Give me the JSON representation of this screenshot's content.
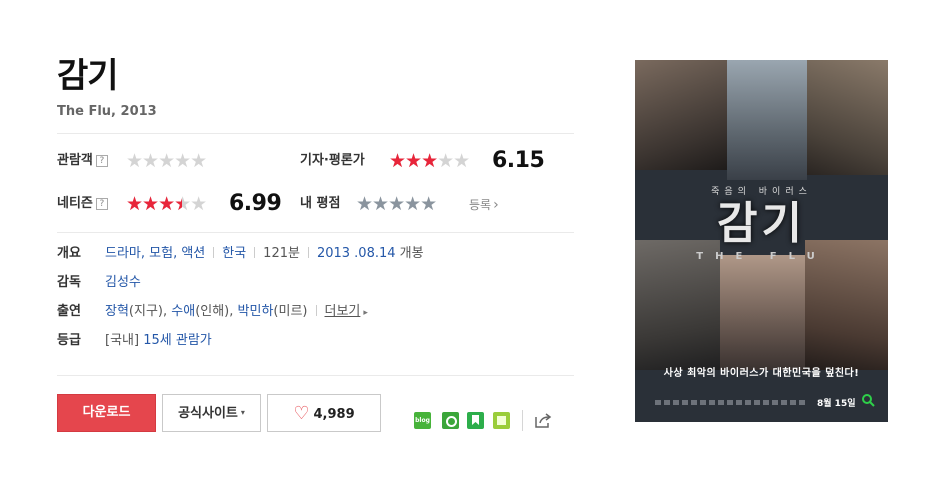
{
  "movie": {
    "title": "감기",
    "subtitle": "The Flu, 2013"
  },
  "ratings": {
    "audience": {
      "label": "관람객",
      "help": "?",
      "score_fraction": 0
    },
    "critic": {
      "label": "기자·평론가",
      "score": "6.15",
      "score_fraction": 0.615
    },
    "netizen": {
      "label": "네티즌",
      "help": "?",
      "score": "6.99",
      "score_fraction": 0.699
    },
    "my": {
      "label": "내 평점",
      "register": "등록",
      "register_arrow": "›",
      "score_fraction": 0
    },
    "star_glyphs": "★★★★★",
    "colors": {
      "filled": "#e8253a",
      "empty": "#d4d4d4",
      "my_empty": "#8a949e"
    }
  },
  "info": {
    "overview": {
      "label": "개요",
      "genres": "드라마, 모험, 액션",
      "country": "한국",
      "runtime": "121분",
      "release_date": "2013 .08.14",
      "release_suffix": " 개봉"
    },
    "director": {
      "label": "감독",
      "name": "김성수"
    },
    "cast": {
      "label": "출연",
      "actors": [
        {
          "name": "장혁",
          "role": "(지구)"
        },
        {
          "name": "수애",
          "role": "(인해)"
        },
        {
          "name": "박민하",
          "role": "(미르)"
        }
      ],
      "more": "더보기",
      "more_arrow": "▸"
    },
    "rating_grade": {
      "label": "등급",
      "region": "[국내]",
      "grade": "15세 관람가"
    }
  },
  "actions": {
    "download": "다운로드",
    "official_site": "공식사이트",
    "official_caret": "▾",
    "like_icon": "heart-icon",
    "like_glyph": "♡",
    "like_count": "4,989"
  },
  "share": {
    "items": [
      "blog-icon",
      "me-icon",
      "bookmark-icon",
      "memo-icon"
    ],
    "blog_label": "blog",
    "share_icon": "share-out-icon"
  },
  "poster": {
    "top_text": "죽음의 바이러스",
    "title_ko": "감기",
    "title_en": "THE FLU",
    "tagline": "사상 최악의 바이러스가 대한민국을 덮친다!",
    "date": "8월 15일",
    "search_glyph": "🔍"
  }
}
